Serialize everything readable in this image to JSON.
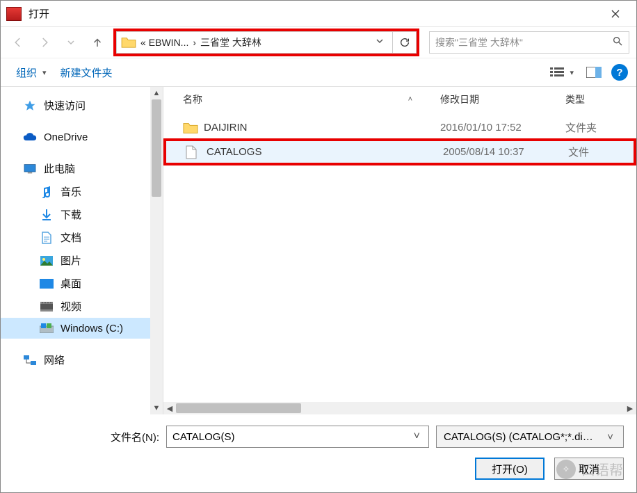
{
  "title": "打开",
  "breadcrumb": {
    "root": "«",
    "parent": "EBWIN...",
    "current": "三省堂 大辞林"
  },
  "search": {
    "placeholder": "搜索\"三省堂 大辞林\""
  },
  "toolbar": {
    "organize": "组织",
    "newfolder": "新建文件夹"
  },
  "columns": {
    "name": "名称",
    "date": "修改日期",
    "type": "类型"
  },
  "sidebar": {
    "quick": "快速访问",
    "onedrive": "OneDrive",
    "thispc": "此电脑",
    "music": "音乐",
    "downloads": "下载",
    "documents": "文档",
    "pictures": "图片",
    "desktop": "桌面",
    "videos": "视频",
    "cdrive": "Windows (C:)",
    "network": "网络"
  },
  "files": [
    {
      "name": "DAIJIRIN",
      "date": "2016/01/10 17:52",
      "type": "文件夹",
      "kind": "folder",
      "highlighted": false
    },
    {
      "name": "CATALOGS",
      "date": "2005/08/14 10:37",
      "type": "文件",
      "kind": "file",
      "highlighted": true
    }
  ],
  "filename": {
    "label": "文件名(N):",
    "value": "CATALOG(S)"
  },
  "filter": {
    "label": "CATALOG(S) (CATALOG*;*.di…"
  },
  "buttons": {
    "open": "打开(O)",
    "cancel": "取消"
  },
  "watermark": "口语帮"
}
